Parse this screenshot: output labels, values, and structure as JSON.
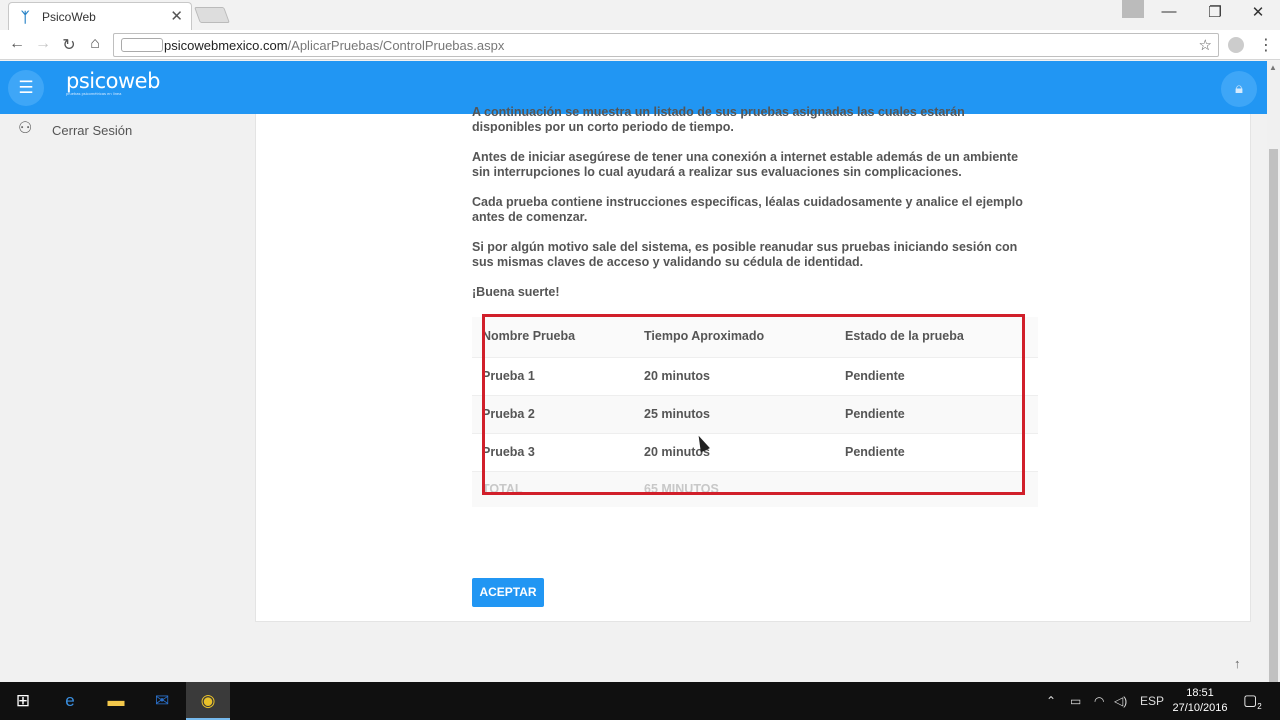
{
  "browser": {
    "tab_title": "PsicoWeb",
    "url_host": "psicowebmexico.com",
    "url_path": "/AplicarPruebas/ControlPruebas.aspx"
  },
  "app": {
    "logo_text": "psicoweb",
    "logo_tagline": "pruebas psicométricas en línea"
  },
  "sidebar": {
    "items": [
      {
        "label": "Cerrar Sesión",
        "icon": "user-icon"
      }
    ]
  },
  "content": {
    "intro_partial": "A continuación se muestra un listado de sus pruebas asignadas las cuales estarán disponibles por un corto periodo de tiempo.",
    "para1": "Antes de iniciar asegúrese de tener una conexión a internet estable además de un ambiente sin interrupciones lo cual ayudará a realizar sus evaluaciones sin complicaciones.",
    "para2": "Cada prueba contiene instrucciones especificas, léalas cuidadosamente y analice el ejemplo antes de comenzar.",
    "para3": "Si por algún motivo sale del sistema, es posible reanudar sus pruebas iniciando sesión con sus mismas claves de acceso y validando su cédula de identidad.",
    "good_luck": "¡Buena suerte!"
  },
  "table": {
    "headers": [
      "Nombre Prueba",
      "Tiempo Aproximado",
      "Estado de la prueba"
    ],
    "rows": [
      [
        "Prueba 1",
        "20 minutos",
        "Pendiente"
      ],
      [
        "Prueba 2",
        "25 minutos",
        "Pendiente"
      ],
      [
        "Prueba 3",
        "20 minutos",
        "Pendiente"
      ]
    ],
    "total": [
      "TOTAL",
      "65 MINUTOS",
      ""
    ]
  },
  "actions": {
    "accept_label": "ACEPTAR"
  },
  "taskbar": {
    "language": "ESP",
    "time": "18:51",
    "date": "27/10/2016",
    "notifications": "2"
  },
  "colors": {
    "accent": "#2196f3",
    "highlight_border": "#d11f2a"
  }
}
